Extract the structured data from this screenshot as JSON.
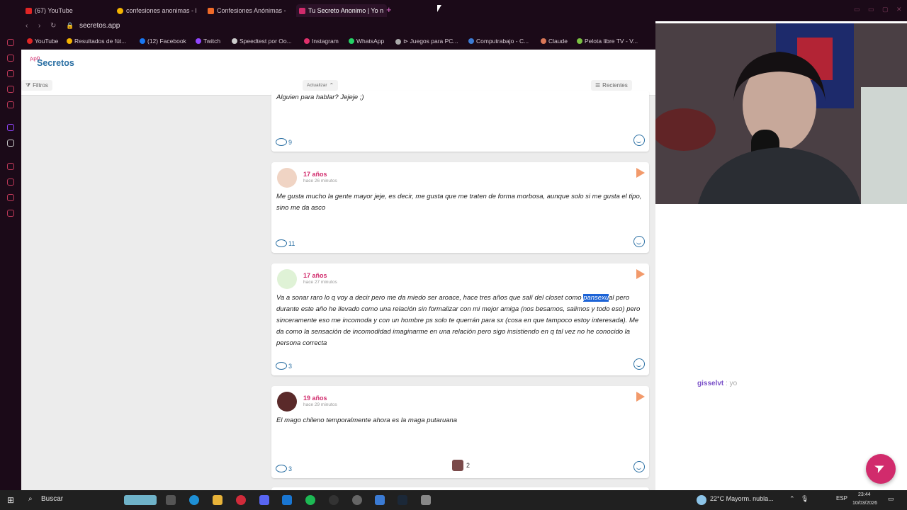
{
  "browser": {
    "tabs": [
      {
        "label": "(67) YouTube",
        "color": "#e02525"
      },
      {
        "label": "confesiones anonimas - B",
        "color": "#f4b400"
      },
      {
        "label": "Confesiones Anónimas - ",
        "color": "#f06a28"
      },
      {
        "label": "Tu Secreto Anonimo | Yo n",
        "color": "#d12b6c"
      }
    ],
    "url": "secretos.app",
    "bookmarks": [
      {
        "label": "YouTube",
        "color": "#e02525"
      },
      {
        "label": "Resultados de fút...",
        "color": "#f4b400"
      },
      {
        "label": "(12) Facebook",
        "color": "#1877f2"
      },
      {
        "label": "Twitch",
        "color": "#9146ff"
      },
      {
        "label": "Speedtest por Oo...",
        "color": "#cccccc"
      },
      {
        "label": "Instagram",
        "color": "#e1306c"
      },
      {
        "label": "WhatsApp",
        "color": "#25d366"
      },
      {
        "label": "⊳ Juegos para PC...",
        "color": "#aaaaaa"
      },
      {
        "label": "Computrabajo - C...",
        "color": "#3b7bd4"
      },
      {
        "label": "Claude",
        "color": "#d97757"
      },
      {
        "label": "Pelota libre TV - V...",
        "color": "#7ac142"
      }
    ]
  },
  "app": {
    "logo_small": "App",
    "logo": "Secretos",
    "filters_label": "Filtros",
    "refresh_label": "Actualizar",
    "recent_label": "Recientes"
  },
  "posts": [
    {
      "text": "Alguien para hablar? Jejeje ;)",
      "comments": "9"
    },
    {
      "age": "17 años",
      "time": "hace 26 minutos",
      "text": "Me gusta mucho la gente mayor jeje, es decir, me gusta que me traten de forma morbosa, aunque solo si me gusta el tipo, sino me da asco",
      "comments": "11"
    },
    {
      "age": "17 años",
      "time": "hace 27 minutos",
      "text_before": "Va a sonar raro lo q voy a decir pero me da miedo ser aroace, hace tres años que salí del closet como ",
      "text_highlight": "pansexu",
      "text_after": "al pero durante este año he llevado como una relación sin formalizar con mi mejor amiga (nos besamos, salimos y todo eso) pero sinceramente eso me incomoda y con un hombre ps solo te querrán para sx (cosa en que tampoco estoy interesada). Me da como la sensación de incomodidad imaginarme en una relación pero sigo insistiendo en q tal vez no he conocido la persona correcta",
      "comments": "3"
    },
    {
      "age": "19 años",
      "time": "hace 29 minutos",
      "text": "El mago chileno temporalmente ahora es la maga putaruana",
      "comments": "3",
      "reactions": "2"
    }
  ],
  "chat": {
    "user": "gisselvt",
    "message": ": yo"
  },
  "taskbar": {
    "search": "Buscar",
    "weather": "22°C  Mayorm. nubla...",
    "lang": "ESP",
    "time": "23:44",
    "date": "10/03/2026"
  }
}
